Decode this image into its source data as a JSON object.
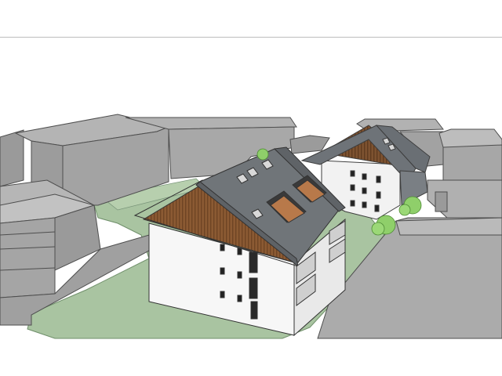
{
  "image": {
    "kind": "3d-architectural-massing-model",
    "colors": {
      "background": "#ffffff",
      "ground_lawn": "#a9c4a1",
      "context_buildings": "#a6a6a6",
      "roof": "#6e7378",
      "timber_cladding": "#8b5a33",
      "facade": "#f7f7f7",
      "trees": "#8fcf6a"
    }
  }
}
